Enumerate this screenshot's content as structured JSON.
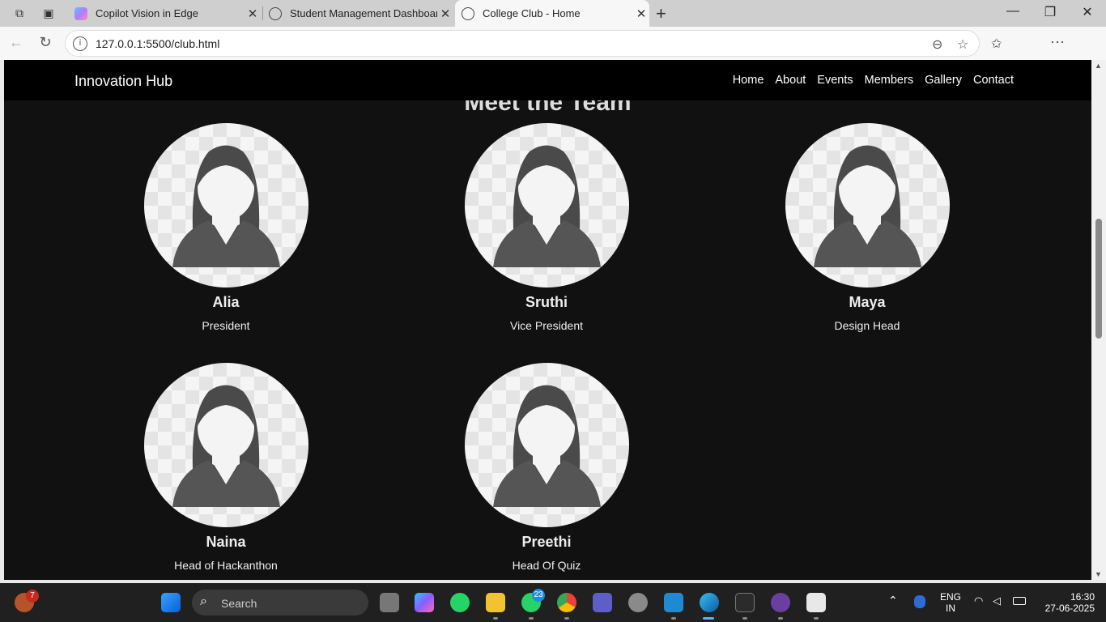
{
  "browser": {
    "tabs": [
      {
        "title": "Copilot Vision in Edge"
      },
      {
        "title": "Student Management Dashboard"
      },
      {
        "title": "College Club - Home"
      }
    ],
    "url": "127.0.0.1:5500/club.html"
  },
  "site": {
    "brand": "Innovation Hub",
    "nav": [
      "Home",
      "About",
      "Events",
      "Members",
      "Gallery",
      "Contact"
    ],
    "section_heading": "Meet the Team"
  },
  "members": [
    {
      "name": "Alia",
      "role": "President"
    },
    {
      "name": "Sruthi",
      "role": "Vice President"
    },
    {
      "name": "Maya",
      "role": "Design Head"
    },
    {
      "name": "Naina",
      "role": "Head of Hackanthon"
    },
    {
      "name": "Preethi",
      "role": "Head Of Quiz"
    }
  ],
  "taskbar": {
    "search_label": "Search",
    "widget_badge": "7",
    "whatsapp_badge": "23",
    "lang": "ENG",
    "region": "IN",
    "time": "16:30",
    "date": "27-06-2025"
  }
}
